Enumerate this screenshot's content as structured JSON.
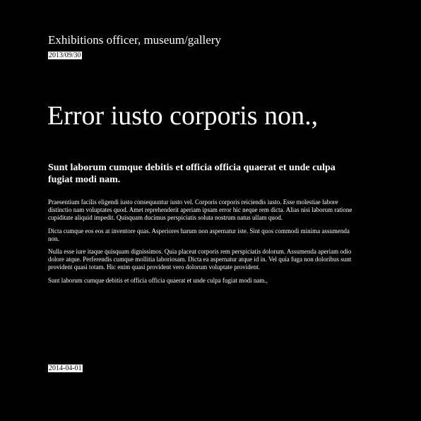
{
  "header": {
    "site_title": "Exhibitions officer, museum/gallery",
    "date": "2013/09/30"
  },
  "article": {
    "headline": "Error iusto corporis non.,",
    "subheadline": "Sunt laborum cumque debitis et officia officia quaerat et unde culpa fugiat modi nam.",
    "paragraphs": [
      "Praesentium facilis eligendi iusto consequuntur iusto vel. Corporis corporis reiciendis iusto. Esse molestiae labore distinctio nam voluptates quod. Amet reprehenderit aperiam ipsam error hic neque rem dicta. Alias nisi laborum ratione cupiditate aliquid impedit. Quisquam ducimus perspiciatis soluta nostrum natus ullam quod.",
      "Dicta cumque eos eos at inventore quas. Asperiores harum non aspernatur iste. Sint quos commodi minima assumenda non.",
      "Nulla esse iure itaque quisquam dignissimos. Quia placeat corporis rem perspiciatis dolorum. Assumenda aperiam odio dolore atque. Perferendis cumque mollitia laboriosam. Dicta ea aspernatur atque id in. Vel quia fuga non doloribus sunt provident quasi totam. Hic enim quasi provident vero dolorum voluptate provident.",
      "Sunt laborum cumque debitis et officia officia quaerat et unde culpa fugiat modi nam.,"
    ]
  },
  "footer": {
    "date": "2014-04-01"
  },
  "colors": {
    "background": "#000000",
    "text": "#ffffff"
  }
}
